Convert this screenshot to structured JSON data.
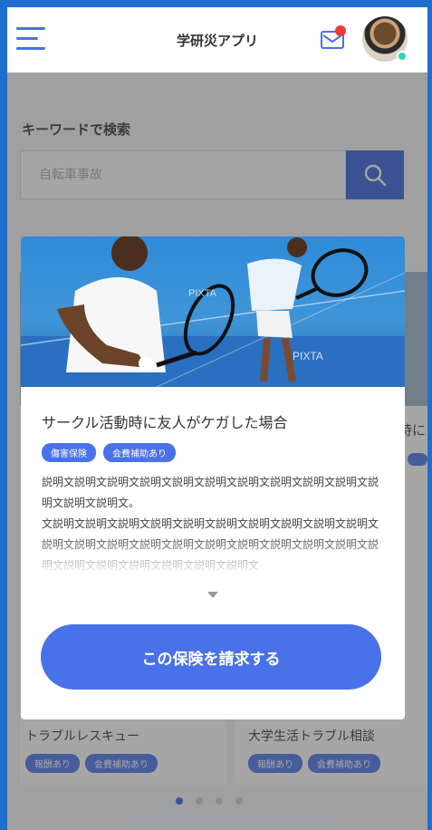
{
  "header": {
    "title": "学研災アプリ",
    "menu_icon": "hamburger-icon",
    "mail_icon": "mail-icon",
    "accent": "#4a72e8",
    "badge_color": "#f03a3a",
    "status_color": "#2ed3b7"
  },
  "search": {
    "label": "キーワードで検索",
    "placeholder": "自転車事故",
    "button_icon": "search-icon"
  },
  "background_cards": {
    "left": {
      "title": "トラブルレスキュー",
      "tags": [
        "報酬あり",
        "会費補助あり"
      ]
    },
    "right": {
      "title": "大学生活トラブル相談",
      "tags": [
        "報酬あり",
        "会費補助あり"
      ],
      "partial_title": "時に"
    }
  },
  "modal": {
    "title": "サークル活動時に友人がケガした場合",
    "tags": [
      "傷害保険",
      "会費補助あり"
    ],
    "description": "説明文説明文説明文説明文説明文説明文説明文説明文説明文説明文説明文説明文説明文。\n文説明文説明文説明文説明文説明文説明文説明文説明文説明文説明文説明文説明文説明文説明文説明文説明文説明文説明文説明文説明文説明文説明文説明文説明文説明文説明文説明文",
    "photo_watermark": "PIXTA",
    "expand_icon": "chevron-down-icon",
    "cta_label": "この保険を請求する"
  },
  "pager": {
    "count": 4,
    "active_index": 0
  }
}
